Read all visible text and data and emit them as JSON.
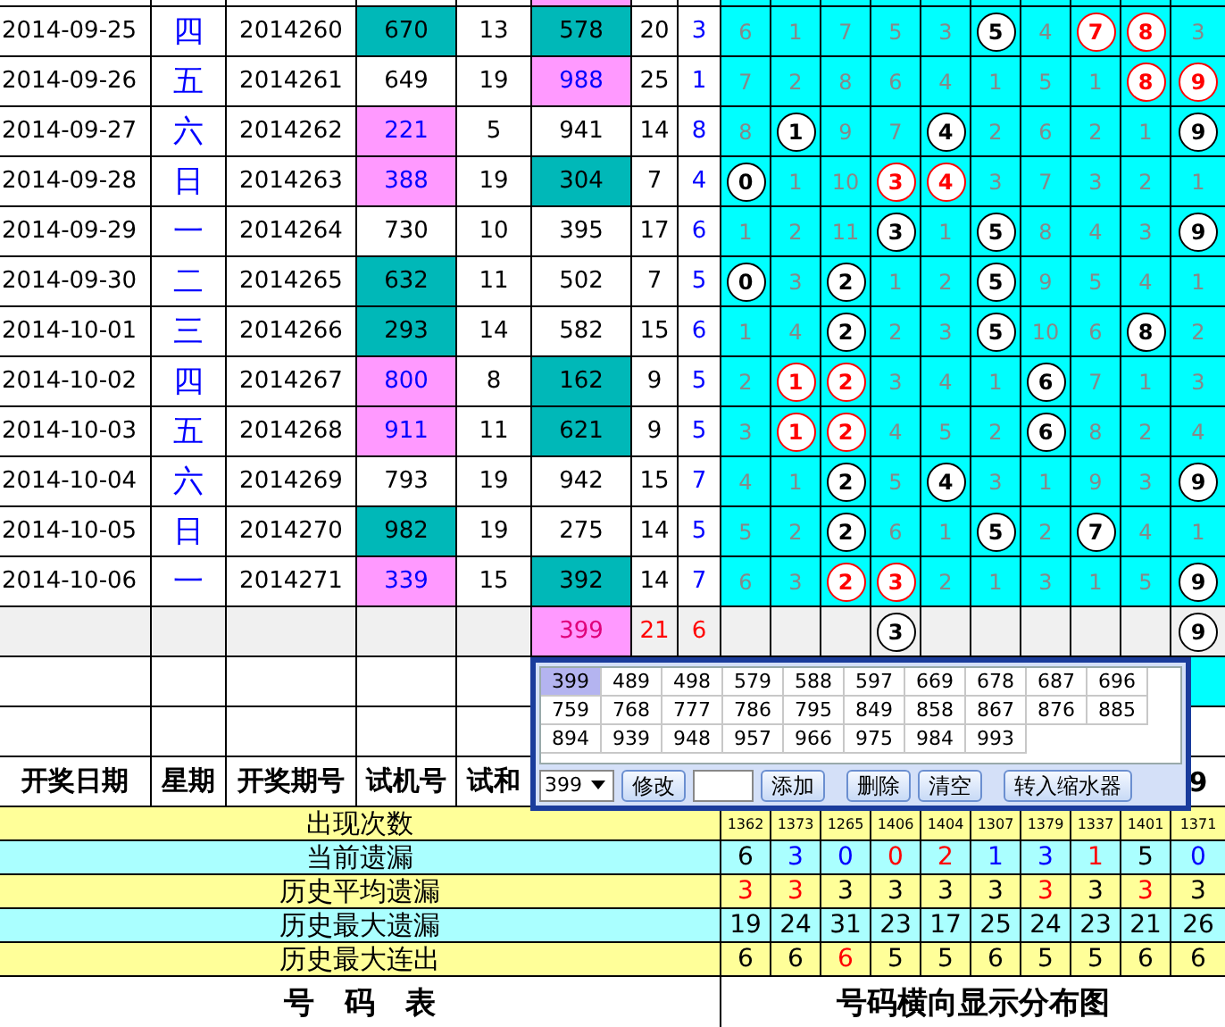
{
  "rows": [
    {
      "date": "2014-09-25",
      "weekday": "四",
      "period": "2014260",
      "test_number": {
        "value": "670",
        "kind": "teal"
      },
      "test_sum": "13",
      "column_6": {
        "value": "578",
        "kind": "teal"
      },
      "column_7": "20",
      "column_8": "3",
      "cells": [
        {
          "value": "6",
          "kind": "miss"
        },
        {
          "value": "1",
          "kind": "miss"
        },
        {
          "value": "7",
          "kind": "miss"
        },
        {
          "value": "5",
          "kind": "miss"
        },
        {
          "value": "3",
          "kind": "miss"
        },
        {
          "value": "5",
          "kind": "hit"
        },
        {
          "value": "4",
          "kind": "miss"
        },
        {
          "value": "7",
          "kind": "repeat"
        },
        {
          "value": "8",
          "kind": "repeat"
        },
        {
          "value": "3",
          "kind": "miss"
        }
      ]
    },
    {
      "date": "2014-09-26",
      "weekday": "五",
      "period": "2014261",
      "test_number": {
        "value": "649",
        "kind": "plain"
      },
      "test_sum": "19",
      "column_6": {
        "value": "988",
        "kind": "pink"
      },
      "column_7": "25",
      "column_8": "1",
      "cells": [
        {
          "value": "7",
          "kind": "miss"
        },
        {
          "value": "2",
          "kind": "miss"
        },
        {
          "value": "8",
          "kind": "miss"
        },
        {
          "value": "6",
          "kind": "miss"
        },
        {
          "value": "4",
          "kind": "miss"
        },
        {
          "value": "1",
          "kind": "miss"
        },
        {
          "value": "5",
          "kind": "miss"
        },
        {
          "value": "1",
          "kind": "miss"
        },
        {
          "value": "8",
          "kind": "repeat"
        },
        {
          "value": "9",
          "kind": "repeat"
        }
      ]
    },
    {
      "date": "2014-09-27",
      "weekday": "六",
      "period": "2014262",
      "test_number": {
        "value": "221",
        "kind": "pink"
      },
      "test_sum": "5",
      "column_6": {
        "value": "941",
        "kind": "plain"
      },
      "column_7": "14",
      "column_8": "8",
      "cells": [
        {
          "value": "8",
          "kind": "miss"
        },
        {
          "value": "1",
          "kind": "hit"
        },
        {
          "value": "9",
          "kind": "miss"
        },
        {
          "value": "7",
          "kind": "miss"
        },
        {
          "value": "4",
          "kind": "hit"
        },
        {
          "value": "2",
          "kind": "miss"
        },
        {
          "value": "6",
          "kind": "miss"
        },
        {
          "value": "2",
          "kind": "miss"
        },
        {
          "value": "1",
          "kind": "miss"
        },
        {
          "value": "9",
          "kind": "hit"
        }
      ]
    },
    {
      "date": "2014-09-28",
      "weekday": "日",
      "period": "2014263",
      "test_number": {
        "value": "388",
        "kind": "pink"
      },
      "test_sum": "19",
      "column_6": {
        "value": "304",
        "kind": "teal"
      },
      "column_7": "7",
      "column_8": "4",
      "cells": [
        {
          "value": "0",
          "kind": "hit"
        },
        {
          "value": "1",
          "kind": "miss"
        },
        {
          "value": "10",
          "kind": "miss"
        },
        {
          "value": "3",
          "kind": "repeat"
        },
        {
          "value": "4",
          "kind": "repeat"
        },
        {
          "value": "3",
          "kind": "miss"
        },
        {
          "value": "7",
          "kind": "miss"
        },
        {
          "value": "3",
          "kind": "miss"
        },
        {
          "value": "2",
          "kind": "miss"
        },
        {
          "value": "1",
          "kind": "miss"
        }
      ]
    },
    {
      "date": "2014-09-29",
      "weekday": "一",
      "period": "2014264",
      "test_number": {
        "value": "730",
        "kind": "plain"
      },
      "test_sum": "10",
      "column_6": {
        "value": "395",
        "kind": "plain"
      },
      "column_7": "17",
      "column_8": "6",
      "cells": [
        {
          "value": "1",
          "kind": "miss"
        },
        {
          "value": "2",
          "kind": "miss"
        },
        {
          "value": "11",
          "kind": "miss"
        },
        {
          "value": "3",
          "kind": "hit"
        },
        {
          "value": "1",
          "kind": "miss"
        },
        {
          "value": "5",
          "kind": "hit"
        },
        {
          "value": "8",
          "kind": "miss"
        },
        {
          "value": "4",
          "kind": "miss"
        },
        {
          "value": "3",
          "kind": "miss"
        },
        {
          "value": "9",
          "kind": "hit"
        }
      ]
    },
    {
      "date": "2014-09-30",
      "weekday": "二",
      "period": "2014265",
      "test_number": {
        "value": "632",
        "kind": "teal"
      },
      "test_sum": "11",
      "column_6": {
        "value": "502",
        "kind": "plain"
      },
      "column_7": "7",
      "column_8": "5",
      "cells": [
        {
          "value": "0",
          "kind": "hit"
        },
        {
          "value": "3",
          "kind": "miss"
        },
        {
          "value": "2",
          "kind": "hit"
        },
        {
          "value": "1",
          "kind": "miss"
        },
        {
          "value": "2",
          "kind": "miss"
        },
        {
          "value": "5",
          "kind": "hit"
        },
        {
          "value": "9",
          "kind": "miss"
        },
        {
          "value": "5",
          "kind": "miss"
        },
        {
          "value": "4",
          "kind": "miss"
        },
        {
          "value": "1",
          "kind": "miss"
        }
      ]
    },
    {
      "date": "2014-10-01",
      "weekday": "三",
      "period": "2014266",
      "test_number": {
        "value": "293",
        "kind": "teal"
      },
      "test_sum": "14",
      "column_6": {
        "value": "582",
        "kind": "plain"
      },
      "column_7": "15",
      "column_8": "6",
      "cells": [
        {
          "value": "1",
          "kind": "miss"
        },
        {
          "value": "4",
          "kind": "miss"
        },
        {
          "value": "2",
          "kind": "hit"
        },
        {
          "value": "2",
          "kind": "miss"
        },
        {
          "value": "3",
          "kind": "miss"
        },
        {
          "value": "5",
          "kind": "hit"
        },
        {
          "value": "10",
          "kind": "miss"
        },
        {
          "value": "6",
          "kind": "miss"
        },
        {
          "value": "8",
          "kind": "hit"
        },
        {
          "value": "2",
          "kind": "miss"
        }
      ]
    },
    {
      "date": "2014-10-02",
      "weekday": "四",
      "period": "2014267",
      "test_number": {
        "value": "800",
        "kind": "pink"
      },
      "test_sum": "8",
      "column_6": {
        "value": "162",
        "kind": "teal"
      },
      "column_7": "9",
      "column_8": "5",
      "cells": [
        {
          "value": "2",
          "kind": "miss"
        },
        {
          "value": "1",
          "kind": "repeat"
        },
        {
          "value": "2",
          "kind": "repeat"
        },
        {
          "value": "3",
          "kind": "miss"
        },
        {
          "value": "4",
          "kind": "miss"
        },
        {
          "value": "1",
          "kind": "miss"
        },
        {
          "value": "6",
          "kind": "hit"
        },
        {
          "value": "7",
          "kind": "miss"
        },
        {
          "value": "1",
          "kind": "miss"
        },
        {
          "value": "3",
          "kind": "miss"
        }
      ]
    },
    {
      "date": "2014-10-03",
      "weekday": "五",
      "period": "2014268",
      "test_number": {
        "value": "911",
        "kind": "pink"
      },
      "test_sum": "11",
      "column_6": {
        "value": "621",
        "kind": "teal"
      },
      "column_7": "9",
      "column_8": "5",
      "cells": [
        {
          "value": "3",
          "kind": "miss"
        },
        {
          "value": "1",
          "kind": "repeat"
        },
        {
          "value": "2",
          "kind": "repeat"
        },
        {
          "value": "4",
          "kind": "miss"
        },
        {
          "value": "5",
          "kind": "miss"
        },
        {
          "value": "2",
          "kind": "miss"
        },
        {
          "value": "6",
          "kind": "hit"
        },
        {
          "value": "8",
          "kind": "miss"
        },
        {
          "value": "2",
          "kind": "miss"
        },
        {
          "value": "4",
          "kind": "miss"
        }
      ]
    },
    {
      "date": "2014-10-04",
      "weekday": "六",
      "period": "2014269",
      "test_number": {
        "value": "793",
        "kind": "plain"
      },
      "test_sum": "19",
      "column_6": {
        "value": "942",
        "kind": "plain"
      },
      "column_7": "15",
      "column_8": "7",
      "cells": [
        {
          "value": "4",
          "kind": "miss"
        },
        {
          "value": "1",
          "kind": "miss"
        },
        {
          "value": "2",
          "kind": "hit"
        },
        {
          "value": "5",
          "kind": "miss"
        },
        {
          "value": "4",
          "kind": "hit"
        },
        {
          "value": "3",
          "kind": "miss"
        },
        {
          "value": "1",
          "kind": "miss"
        },
        {
          "value": "9",
          "kind": "miss"
        },
        {
          "value": "3",
          "kind": "miss"
        },
        {
          "value": "9",
          "kind": "hit"
        }
      ]
    },
    {
      "date": "2014-10-05",
      "weekday": "日",
      "period": "2014270",
      "test_number": {
        "value": "982",
        "kind": "teal"
      },
      "test_sum": "19",
      "column_6": {
        "value": "275",
        "kind": "plain"
      },
      "column_7": "14",
      "column_8": "5",
      "cells": [
        {
          "value": "5",
          "kind": "miss"
        },
        {
          "value": "2",
          "kind": "miss"
        },
        {
          "value": "2",
          "kind": "hit"
        },
        {
          "value": "6",
          "kind": "miss"
        },
        {
          "value": "1",
          "kind": "miss"
        },
        {
          "value": "5",
          "kind": "hit"
        },
        {
          "value": "2",
          "kind": "miss"
        },
        {
          "value": "7",
          "kind": "hit"
        },
        {
          "value": "4",
          "kind": "miss"
        },
        {
          "value": "1",
          "kind": "miss"
        }
      ]
    },
    {
      "date": "2014-10-06",
      "weekday": "一",
      "period": "2014271",
      "test_number": {
        "value": "339",
        "kind": "pink"
      },
      "test_sum": "15",
      "column_6": {
        "value": "392",
        "kind": "teal"
      },
      "column_7": "14",
      "column_8": "7",
      "cells": [
        {
          "value": "6",
          "kind": "miss"
        },
        {
          "value": "3",
          "kind": "miss"
        },
        {
          "value": "2",
          "kind": "repeat"
        },
        {
          "value": "3",
          "kind": "repeat"
        },
        {
          "value": "2",
          "kind": "miss"
        },
        {
          "value": "1",
          "kind": "miss"
        },
        {
          "value": "3",
          "kind": "miss"
        },
        {
          "value": "1",
          "kind": "miss"
        },
        {
          "value": "5",
          "kind": "miss"
        },
        {
          "value": "9",
          "kind": "hit"
        }
      ]
    }
  ],
  "summary_row": {
    "column_6": "399",
    "column_7": "21",
    "column_8": "6",
    "cells": [
      {
        "kind": "empty"
      },
      {
        "kind": "empty"
      },
      {
        "kind": "empty"
      },
      {
        "value": "3",
        "kind": "hit"
      },
      {
        "kind": "empty"
      },
      {
        "kind": "empty"
      },
      {
        "kind": "empty"
      },
      {
        "kind": "empty"
      },
      {
        "kind": "empty"
      },
      {
        "value": "9",
        "kind": "hit"
      }
    ]
  },
  "header": {
    "date": "开奖日期",
    "weekday": "星期",
    "period": "开奖期号",
    "test_number": "试机号",
    "test_sum": "试和",
    "column_18": "9"
  },
  "stats": [
    {
      "label": "出现次数",
      "kind": "yellow",
      "values": [
        {
          "value": "1362",
          "color": "#000000"
        },
        {
          "value": "1373",
          "color": "#000000"
        },
        {
          "value": "1265",
          "color": "#000000"
        },
        {
          "value": "1406",
          "color": "#000000"
        },
        {
          "value": "1404",
          "color": "#000000"
        },
        {
          "value": "1307",
          "color": "#000000"
        },
        {
          "value": "1379",
          "color": "#000000"
        },
        {
          "value": "1337",
          "color": "#000000"
        },
        {
          "value": "1401",
          "color": "#000000"
        },
        {
          "value": "1371",
          "color": "#000000"
        }
      ]
    },
    {
      "label": "当前遗漏",
      "kind": "cyan",
      "values": [
        {
          "value": "6",
          "color": "#000000"
        },
        {
          "value": "3",
          "color": "#0000ff"
        },
        {
          "value": "0",
          "color": "#0000ff"
        },
        {
          "value": "0",
          "color": "#ff0000"
        },
        {
          "value": "2",
          "color": "#ff0000"
        },
        {
          "value": "1",
          "color": "#0000ff"
        },
        {
          "value": "3",
          "color": "#0000ff"
        },
        {
          "value": "1",
          "color": "#ff0000"
        },
        {
          "value": "5",
          "color": "#000000"
        },
        {
          "value": "0",
          "color": "#0000ff"
        }
      ]
    },
    {
      "label": "历史平均遗漏",
      "kind": "yellow",
      "values": [
        {
          "value": "3",
          "color": "#ff0000"
        },
        {
          "value": "3",
          "color": "#ff0000"
        },
        {
          "value": "3",
          "color": "#000000"
        },
        {
          "value": "3",
          "color": "#000000"
        },
        {
          "value": "3",
          "color": "#000000"
        },
        {
          "value": "3",
          "color": "#000000"
        },
        {
          "value": "3",
          "color": "#ff0000"
        },
        {
          "value": "3",
          "color": "#000000"
        },
        {
          "value": "3",
          "color": "#ff0000"
        },
        {
          "value": "3",
          "color": "#000000"
        }
      ]
    },
    {
      "label": "历史最大遗漏",
      "kind": "cyan",
      "values": [
        {
          "value": "19",
          "color": "#000000"
        },
        {
          "value": "24",
          "color": "#000000"
        },
        {
          "value": "31",
          "color": "#000000"
        },
        {
          "value": "23",
          "color": "#000000"
        },
        {
          "value": "17",
          "color": "#000000"
        },
        {
          "value": "25",
          "color": "#000000"
        },
        {
          "value": "24",
          "color": "#000000"
        },
        {
          "value": "23",
          "color": "#000000"
        },
        {
          "value": "21",
          "color": "#000000"
        },
        {
          "value": "26",
          "color": "#000000"
        }
      ]
    },
    {
      "label": "历史最大连出",
      "kind": "yellow",
      "values": [
        {
          "value": "6",
          "color": "#000000"
        },
        {
          "value": "6",
          "color": "#000000"
        },
        {
          "value": "6",
          "color": "#ff0000"
        },
        {
          "value": "5",
          "color": "#000000"
        },
        {
          "value": "5",
          "color": "#000000"
        },
        {
          "value": "6",
          "color": "#000000"
        },
        {
          "value": "5",
          "color": "#000000"
        },
        {
          "value": "5",
          "color": "#000000"
        },
        {
          "value": "6",
          "color": "#000000"
        },
        {
          "value": "6",
          "color": "#000000"
        }
      ]
    }
  ],
  "footer": {
    "left": "号　码　表",
    "right": "号码横向显示分布图"
  },
  "popup": {
    "numbers": [
      {
        "value": "399",
        "selected": true
      },
      {
        "value": "489",
        "selected": false
      },
      {
        "value": "498",
        "selected": false
      },
      {
        "value": "579",
        "selected": false
      },
      {
        "value": "588",
        "selected": false
      },
      {
        "value": "597",
        "selected": false
      },
      {
        "value": "669",
        "selected": false
      },
      {
        "value": "678",
        "selected": false
      },
      {
        "value": "687",
        "selected": false
      },
      {
        "value": "696",
        "selected": false
      },
      {
        "value": "759",
        "selected": false
      },
      {
        "value": "768",
        "selected": false
      },
      {
        "value": "777",
        "selected": false
      },
      {
        "value": "786",
        "selected": false
      },
      {
        "value": "795",
        "selected": false
      },
      {
        "value": "849",
        "selected": false
      },
      {
        "value": "858",
        "selected": false
      },
      {
        "value": "867",
        "selected": false
      },
      {
        "value": "876",
        "selected": false
      },
      {
        "value": "885",
        "selected": false
      },
      {
        "value": "894",
        "selected": false
      },
      {
        "value": "939",
        "selected": false
      },
      {
        "value": "948",
        "selected": false
      },
      {
        "value": "957",
        "selected": false
      },
      {
        "value": "966",
        "selected": false
      },
      {
        "value": "975",
        "selected": false
      },
      {
        "value": "984",
        "selected": false
      },
      {
        "value": "993",
        "selected": false
      }
    ],
    "combo_value": "399",
    "buttons": [
      "修改",
      "添加",
      "删除",
      "清空",
      "转入缩水器"
    ]
  }
}
